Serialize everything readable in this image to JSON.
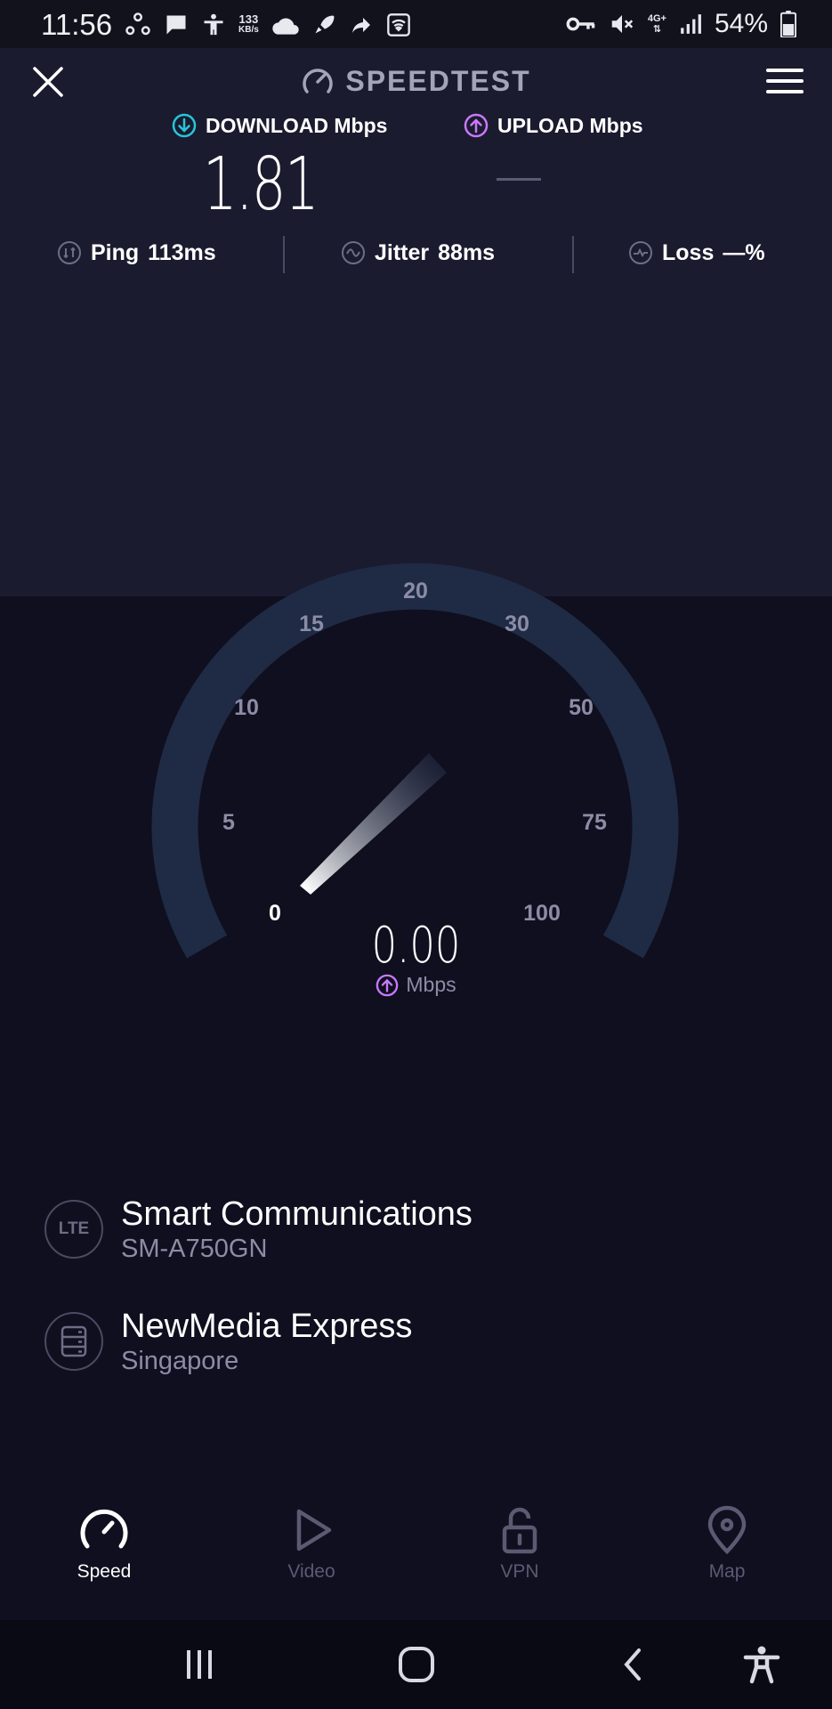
{
  "status_bar": {
    "time": "11:56",
    "kbs_value": "133",
    "kbs_unit": "KB/s",
    "network_type": "4G+",
    "battery": "54%"
  },
  "header": {
    "title": "SPEEDTEST"
  },
  "download": {
    "label": "DOWNLOAD Mbps",
    "value": "1.81",
    "color": "#26c6da"
  },
  "upload": {
    "label": "UPLOAD Mbps",
    "value": "—",
    "color": "#c879f9"
  },
  "stats": {
    "ping_label": "Ping",
    "ping_value": "113ms",
    "jitter_label": "Jitter",
    "jitter_value": "88ms",
    "loss_label": "Loss",
    "loss_value": "—%"
  },
  "gauge": {
    "ticks": [
      "0",
      "5",
      "10",
      "15",
      "20",
      "30",
      "50",
      "75",
      "100"
    ],
    "current_value": "0.00",
    "unit": "Mbps"
  },
  "provider": {
    "badge": "LTE",
    "name": "Smart Communications",
    "device": "SM-A750GN"
  },
  "server": {
    "name": "NewMedia Express",
    "location": "Singapore"
  },
  "tabs": [
    {
      "label": "Speed",
      "icon": "speedometer-icon",
      "active": true
    },
    {
      "label": "Video",
      "icon": "play-icon",
      "active": false
    },
    {
      "label": "VPN",
      "icon": "unlock-icon",
      "active": false
    },
    {
      "label": "Map",
      "icon": "map-pin-icon",
      "active": false
    }
  ]
}
